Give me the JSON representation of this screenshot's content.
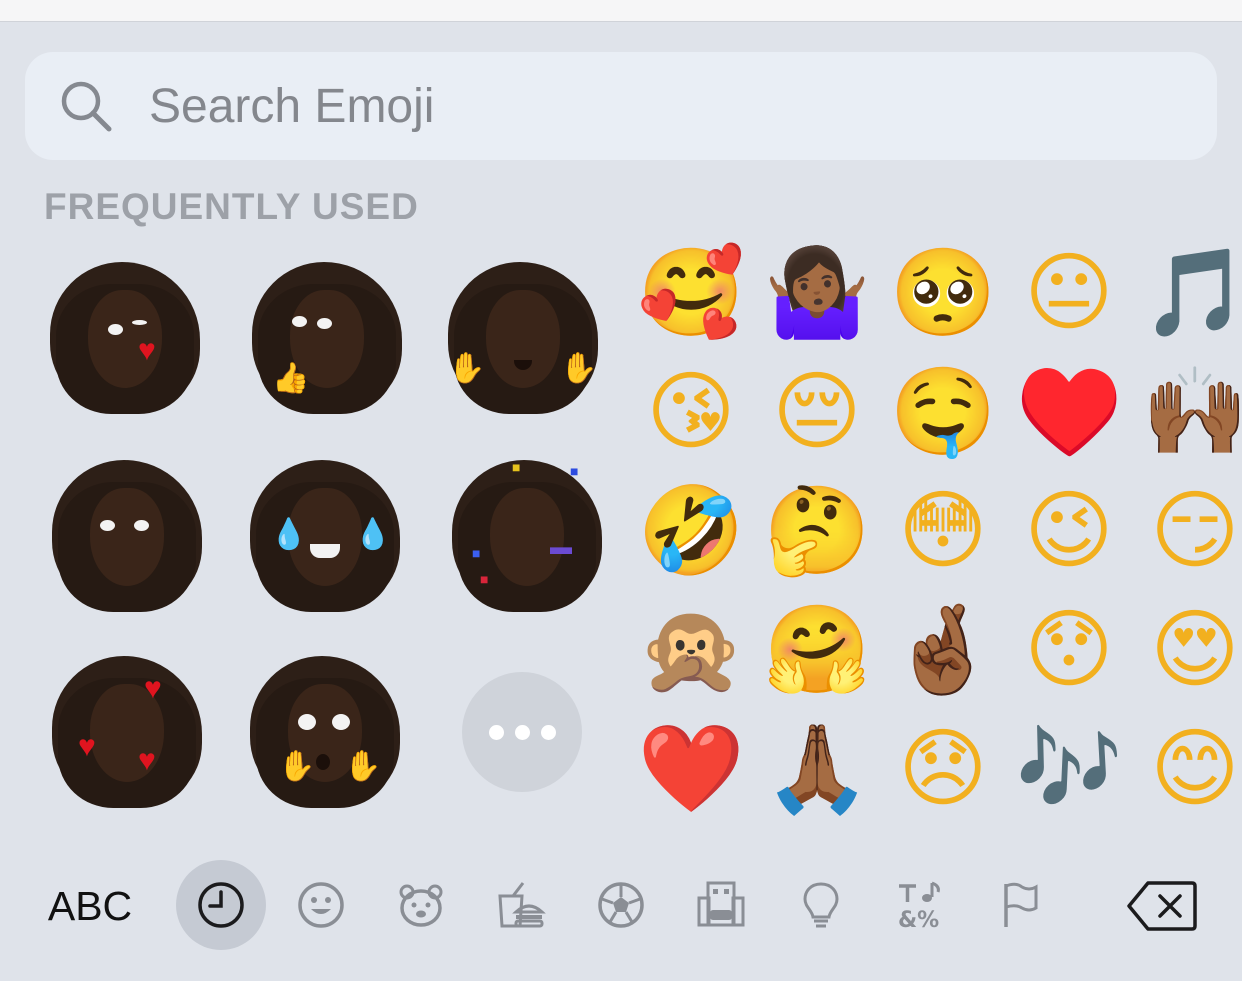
{
  "search": {
    "placeholder": "Search Emoji"
  },
  "section": {
    "title": "FREQUENTLY USED"
  },
  "stickers": [
    {
      "name": "memoji-heart-wink"
    },
    {
      "name": "memoji-thumbs-up"
    },
    {
      "name": "memoji-jazz-hands"
    },
    {
      "name": "memoji-plain"
    },
    {
      "name": "memoji-tears-of-joy"
    },
    {
      "name": "memoji-party"
    },
    {
      "name": "memoji-hearts"
    },
    {
      "name": "memoji-shocked"
    }
  ],
  "emojis": [
    {
      "char": "🥰",
      "name": "smiling-face-with-hearts",
      "tone": ""
    },
    {
      "char": "🤷🏾‍♀️",
      "name": "woman-shrugging",
      "tone": "purple"
    },
    {
      "char": "🥺",
      "name": "pleading-face",
      "tone": ""
    },
    {
      "char": "😐",
      "name": "neutral-face",
      "tone": ""
    },
    {
      "char": "🎵",
      "name": "musical-note",
      "tone": "dark"
    },
    {
      "char": "😘",
      "name": "face-blowing-kiss",
      "tone": ""
    },
    {
      "char": "😔",
      "name": "pensive-face",
      "tone": ""
    },
    {
      "char": "🤤",
      "name": "drooling-face",
      "tone": ""
    },
    {
      "char": "♥️",
      "name": "red-heart-suit",
      "tone": "red"
    },
    {
      "char": "🙌🏾",
      "name": "raising-hands",
      "tone": "brown"
    },
    {
      "char": "🤣",
      "name": "rolling-on-floor-laughing",
      "tone": ""
    },
    {
      "char": "🤔",
      "name": "thinking-face",
      "tone": ""
    },
    {
      "char": "😳",
      "name": "flushed-face",
      "tone": ""
    },
    {
      "char": "😉",
      "name": "winking-face",
      "tone": ""
    },
    {
      "char": "😏",
      "name": "smirking-face",
      "tone": ""
    },
    {
      "char": "🙊",
      "name": "speak-no-evil-monkey",
      "tone": "brown"
    },
    {
      "char": "🤗",
      "name": "hugging-face",
      "tone": ""
    },
    {
      "char": "🤞🏾",
      "name": "crossed-fingers",
      "tone": "brown"
    },
    {
      "char": "😯",
      "name": "hushed-face",
      "tone": ""
    },
    {
      "char": "😍",
      "name": "heart-eyes",
      "tone": ""
    },
    {
      "char": "❤️",
      "name": "red-heart",
      "tone": "red"
    },
    {
      "char": "🙏🏾",
      "name": "folded-hands",
      "tone": "brown"
    },
    {
      "char": "😞",
      "name": "disappointed-face",
      "tone": ""
    },
    {
      "char": "🎶",
      "name": "musical-notes",
      "tone": "dark"
    },
    {
      "char": "😊",
      "name": "smiling-face-with-smiling-eyes",
      "tone": ""
    }
  ],
  "toolbar": {
    "abc_label": "ABC",
    "categories": [
      {
        "icon": "clock-icon",
        "name": "frequently-used",
        "active": true
      },
      {
        "icon": "smiley-icon",
        "name": "smileys-people",
        "active": false
      },
      {
        "icon": "bear-icon",
        "name": "animals-nature",
        "active": false
      },
      {
        "icon": "burger-icon",
        "name": "food-drink",
        "active": false
      },
      {
        "icon": "soccer-ball-icon",
        "name": "activity",
        "active": false
      },
      {
        "icon": "building-icon",
        "name": "travel-places",
        "active": false
      },
      {
        "icon": "lightbulb-icon",
        "name": "objects",
        "active": false
      },
      {
        "icon": "symbols-icon",
        "name": "symbols",
        "active": false
      },
      {
        "icon": "flag-icon",
        "name": "flags",
        "active": false
      }
    ],
    "delete_icon": "backspace-icon"
  },
  "colors": {
    "background": "#dfe3ea",
    "search_bg": "#e9eef5",
    "active_category": "#c5cad3",
    "section_title": "#9da1a8"
  }
}
